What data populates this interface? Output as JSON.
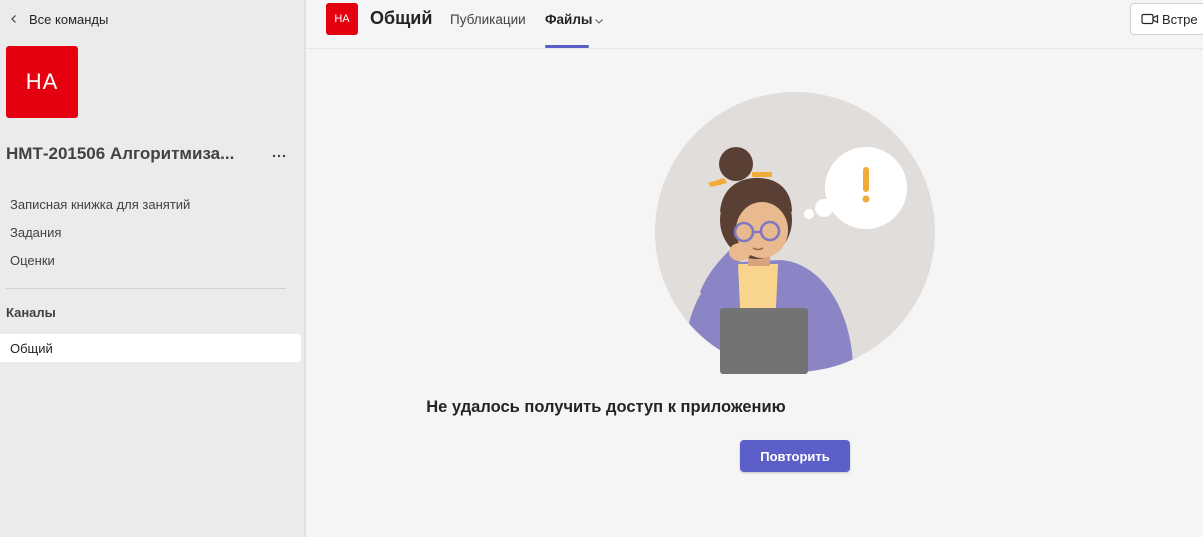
{
  "sidebar": {
    "back_label": "Все команды",
    "team_initials": "НА",
    "team_name": "НМТ-201506 Алгоритмиза...",
    "more_label": "···",
    "items": [
      {
        "label": "Записная книжка для занятий"
      },
      {
        "label": "Задания"
      },
      {
        "label": "Оценки"
      }
    ],
    "channels_heading": "Каналы",
    "channels": [
      {
        "label": "Общий"
      }
    ]
  },
  "header": {
    "channel_initials": "НА",
    "channel_title": "Общий",
    "tabs": [
      {
        "label": "Публикации"
      },
      {
        "label": "Файлы"
      }
    ],
    "meet_label": "Встре"
  },
  "main": {
    "error_title": "Не удалось получить доступ к приложению",
    "retry_label": "Повторить"
  },
  "colors": {
    "accent": "#5b5fc7",
    "team_avatar": "#e5000f"
  }
}
